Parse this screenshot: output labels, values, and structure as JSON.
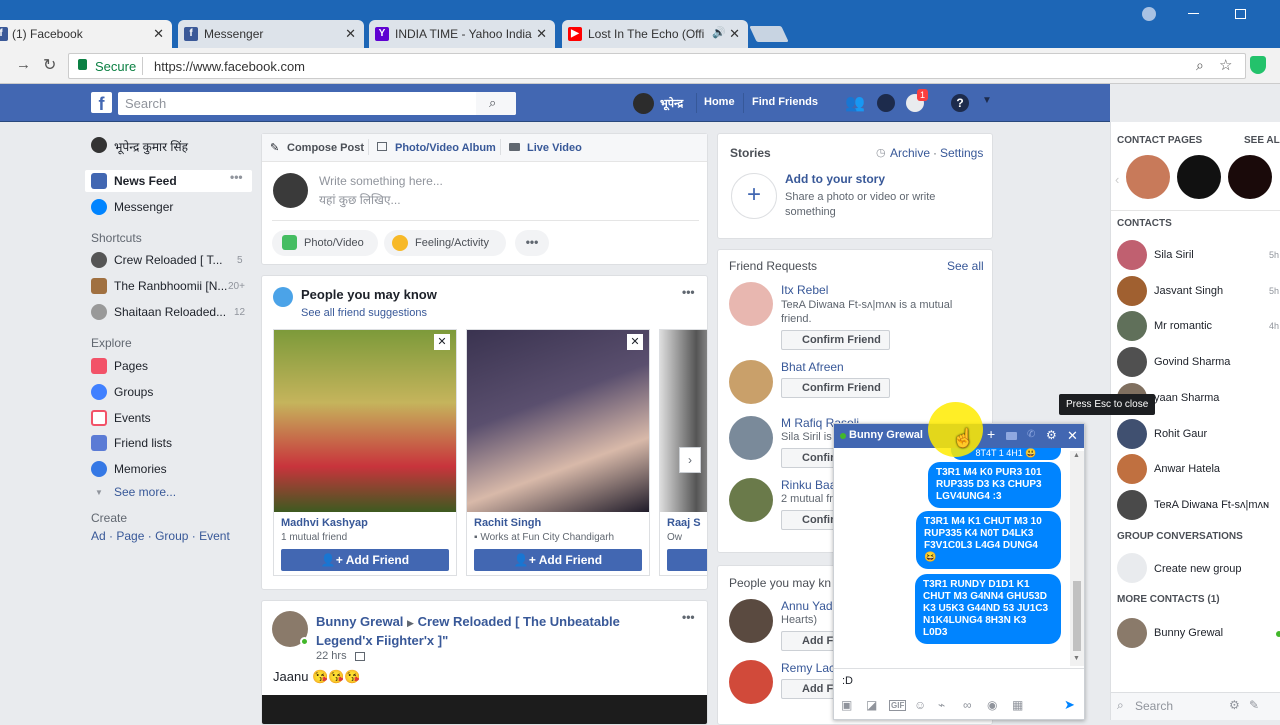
{
  "browser": {
    "tabs": [
      {
        "label": "(1) Facebook",
        "icon": "facebook-icon",
        "color": "#3b5998"
      },
      {
        "label": "Messenger",
        "icon": "facebook-icon",
        "color": "#3b5998"
      },
      {
        "label": "INDIA TIME - Yahoo India",
        "icon": "yahoo-icon",
        "color": "#5f01d1"
      },
      {
        "label": "Lost In The Echo (Offi",
        "icon": "youtube-icon",
        "color": "#ff0000"
      }
    ],
    "secure_label": "Secure",
    "url": "https://www.facebook.com"
  },
  "topbar": {
    "search_placeholder": "Search",
    "profile_name": "भूपेन्द्र",
    "home": "Home",
    "find_friends": "Find Friends",
    "notifications_count": "1",
    "brand_color": "#4267b2"
  },
  "leftnav": {
    "profile_name": "भूपेन्द्र कुमार सिंह",
    "news_feed": "News Feed",
    "messenger": "Messenger",
    "shortcuts_heading": "Shortcuts",
    "shortcuts": [
      {
        "label": "Crew Reloaded [ T...",
        "count": "5"
      },
      {
        "label": "The Ranbhoomii [N...",
        "count": "20+"
      },
      {
        "label": "Shaitaan Reloaded...",
        "count": "12"
      }
    ],
    "explore_heading": "Explore",
    "explore": [
      {
        "label": "Pages",
        "icon": "flag-icon"
      },
      {
        "label": "Groups",
        "icon": "groups-icon"
      },
      {
        "label": "Events",
        "icon": "calendar-icon"
      },
      {
        "label": "Friend lists",
        "icon": "friend-list-icon"
      },
      {
        "label": "Memories",
        "icon": "clock-icon"
      }
    ],
    "see_more": "See more...",
    "create_heading": "Create",
    "create_links": [
      "Ad",
      "Page",
      "Group",
      "Event"
    ]
  },
  "composer": {
    "tabs": [
      "Compose Post",
      "Photo/Video Album",
      "Live Video"
    ],
    "placeholder_en": "Write something here...",
    "placeholder_hi": "यहां कुछ लिखिए...",
    "actions": [
      "Photo/Video",
      "Feeling/Activity"
    ]
  },
  "pymk": {
    "title": "People you may know",
    "subtitle": "See all friend suggestions",
    "people": [
      {
        "name": "Madhvi Kashyap",
        "info": "1 mutual friend"
      },
      {
        "name": "Rachit Singh",
        "info": "Works at Fun City Chandigarh"
      },
      {
        "name": "Raaj S",
        "info": "Ow"
      }
    ],
    "add_label": "Add Friend"
  },
  "post": {
    "author": "Bunny Grewal",
    "group": "Crew Reloaded [ The Unbeatable Legend'x Fiighter'x ]\"",
    "time": "22 hrs",
    "text": "Jaanu 😘😘😘"
  },
  "stories": {
    "title": "Stories",
    "archive": "Archive",
    "settings": "Settings",
    "add_title": "Add to your story",
    "add_desc": "Share a photo or video or write something"
  },
  "friend_requests": {
    "title": "Friend Requests",
    "see_all": "See all",
    "confirm": "Confirm Friend",
    "items": [
      {
        "name": "Itx Rebel",
        "info": "TeʀA Diwaɴa Ft-sʌ|mʌɴ is a mutual friend."
      },
      {
        "name": "Bhat Afreen",
        "info": ""
      },
      {
        "name": "M Rafiq Rasoli",
        "info": "Sila Siril is"
      },
      {
        "name": "Rinku Baa",
        "info": "2 mutual fr"
      }
    ]
  },
  "pymk_side": {
    "title": "People you may kn",
    "items": [
      {
        "name": "Annu Yad",
        "info": "Hearts)"
      },
      {
        "name": "Remy Lac",
        "info": ""
      }
    ],
    "add": "Add F"
  },
  "rail": {
    "contact_pages": "CONTACT PAGES",
    "see_all": "SEE AL",
    "contacts_heading": "CONTACTS",
    "contacts": [
      {
        "name": "Sila Siril",
        "time": "5h"
      },
      {
        "name": "Jasvant Singh",
        "time": "5h"
      },
      {
        "name": "Mr romantic",
        "time": "4h"
      },
      {
        "name": "Govind Sharma",
        "time": ""
      },
      {
        "name": "yaan Sharma",
        "time": ""
      },
      {
        "name": "Rohit Gaur",
        "time": ""
      },
      {
        "name": "Anwar Hatela",
        "time": ""
      },
      {
        "name": "TeʀA Diwaɴa Ft-sʌ|mʌɴ",
        "time": ""
      }
    ],
    "group_heading": "GROUP CONVERSATIONS",
    "create_group": "Create new group",
    "more_heading": "MORE CONTACTS (1)",
    "more": [
      {
        "name": "Bunny Grewal"
      }
    ],
    "search": "Search",
    "tooltip": "Press Esc to close"
  },
  "chat": {
    "name": "Bunny Grewal",
    "partial": "8T4T 1 4H1 😃",
    "messages": [
      "T3R1 M4 K0 PUR3 101 RUP335 D3 K3 CHUP3 LGV4UNG4 :3",
      "T3R1 M4 K1 CHUT M3 10 RUP335 K4 N0T D4LK3 F3V1C0L3 L4G4 DUNG4 😆",
      "T3R1 RUNDY D1D1 K1 CHUT M3 G4NN4 GHU53D K3 U5K3 G44ND 53 JU1C3 N1K4LUNG4 8H3N K3 L0D3"
    ],
    "input": ":D"
  }
}
